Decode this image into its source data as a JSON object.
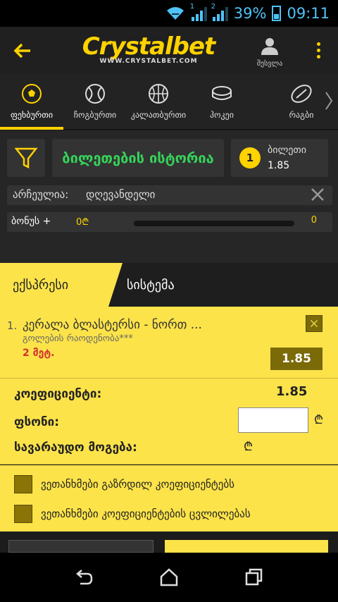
{
  "statusbar": {
    "battery_pct": "39%",
    "time": "09:11",
    "sim1": "1",
    "sim2": "2",
    "accent": "#4fc3f7"
  },
  "header": {
    "logo": "Crystalbet",
    "logo_url": "WWW.CRYSTALBET.COM",
    "login_label": "შესვლა",
    "brand_color": "#ffd200"
  },
  "sports": [
    {
      "label": "ფეხბურთი",
      "icon": "soccer-ball-icon",
      "active": true
    },
    {
      "label": "ჩოგბურთი",
      "icon": "tennis-ball-icon",
      "active": false
    },
    {
      "label": "კალათბურთი",
      "icon": "basketball-icon",
      "active": false
    },
    {
      "label": "ჰოკეი",
      "icon": "hockey-puck-icon",
      "active": false
    },
    {
      "label": "რაგბი",
      "icon": "rugby-ball-icon",
      "active": false
    }
  ],
  "betslip": {
    "history_label": "ბილეთების ისტორია",
    "ticket_count": "1",
    "ticket_label": "ბილეთი",
    "ticket_odd": "1.85",
    "period_label": "არჩეულია:",
    "period_value": "დღევანდელი",
    "bonus_label": "ბონუს +",
    "bonus_amount": "0₾",
    "bonus_progress": 0,
    "bonus_count": "0"
  },
  "bet_tabs": {
    "express": "ექსპრესი",
    "system": "სისტემა",
    "active": "express"
  },
  "event": {
    "number": "1.",
    "teams": "კერალა ბლასტერსი - ნორთ ...",
    "market": "გოლების რაოდენობა***",
    "selection": "2 მეტ.",
    "odd": "1.85"
  },
  "summary": {
    "coef_label": "კოეფიციენტი:",
    "coef_value": "1.85",
    "stake_label": "ფსონი:",
    "stake_value": "",
    "currency": "₾",
    "win_label": "სავარაუდო მოგება:"
  },
  "agreements": [
    {
      "label": "ვეთანხმები გაზრდილ კოეფიციენტებს",
      "checked": false
    },
    {
      "label": "ვეთანხმები კოეფიციენტების ცვლილებას",
      "checked": false
    }
  ],
  "colors": {
    "slip_yellow": "#fce34a",
    "dark_olive": "#7a6a08",
    "history_green": "#36d35a",
    "selection_red": "#d32f2f"
  }
}
